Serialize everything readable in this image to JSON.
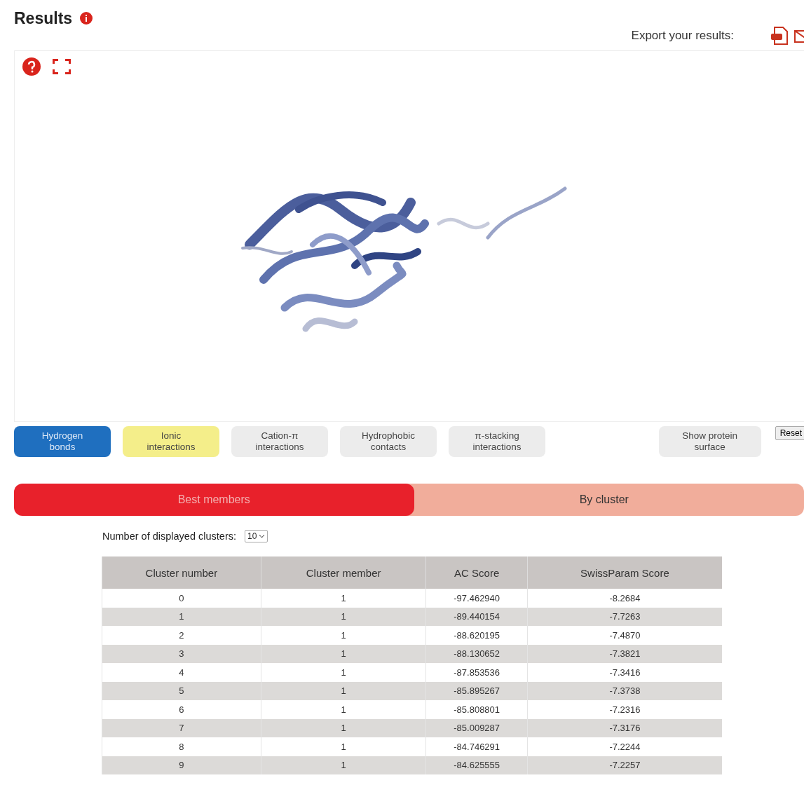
{
  "title": "Results",
  "export": {
    "label": "Export your results:"
  },
  "interactions": [
    {
      "label": "Hydrogen bonds",
      "on": true,
      "color": "#1f6fbf"
    },
    {
      "label": "Ionic interactions",
      "on": true,
      "color": "#f4ee8a"
    },
    {
      "label": "Cation-π interactions",
      "on": false
    },
    {
      "label": "Hydrophobic contacts",
      "on": false
    },
    {
      "label": "π-stacking interactions",
      "on": false
    }
  ],
  "surface_button": {
    "label": "Show protein surface",
    "on": false
  },
  "reset_button": {
    "label": "Reset"
  },
  "tabs": [
    {
      "label": "Best members",
      "selected": true
    },
    {
      "label": "By cluster",
      "selected": false
    }
  ],
  "clusters_select": {
    "label": "Number of displayed clusters:",
    "value": "10"
  },
  "table": {
    "columns": [
      "Cluster number",
      "Cluster member",
      "AC Score",
      "SwissParam Score"
    ],
    "rows": [
      [
        "0",
        "1",
        "-97.462940",
        "-8.2684"
      ],
      [
        "1",
        "1",
        "-89.440154",
        "-7.7263"
      ],
      [
        "2",
        "1",
        "-88.620195",
        "-7.4870"
      ],
      [
        "3",
        "1",
        "-88.130652",
        "-7.3821"
      ],
      [
        "4",
        "1",
        "-87.853536",
        "-7.3416"
      ],
      [
        "5",
        "1",
        "-85.895267",
        "-7.3738"
      ],
      [
        "6",
        "1",
        "-85.808801",
        "-7.2316"
      ],
      [
        "7",
        "1",
        "-85.009287",
        "-7.3176"
      ],
      [
        "8",
        "1",
        "-84.746291",
        "-7.2244"
      ],
      [
        "9",
        "1",
        "-84.625555",
        "-7.2257"
      ]
    ]
  }
}
